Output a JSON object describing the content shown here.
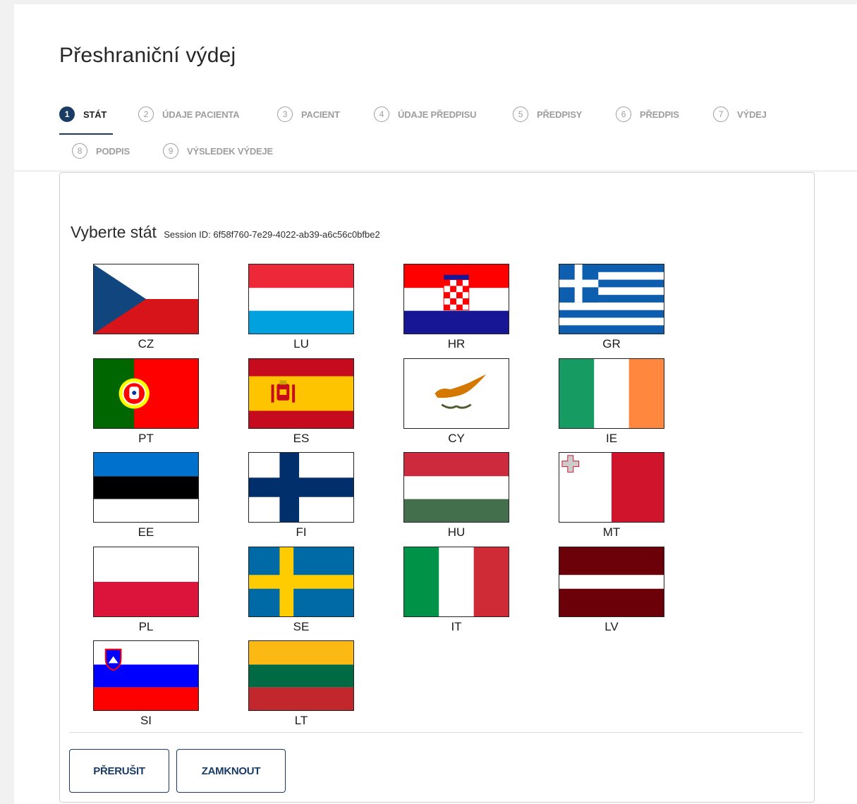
{
  "page": {
    "title": "Přeshraniční výdej"
  },
  "stepper": {
    "steps": [
      {
        "number": "1",
        "label": "STÁT",
        "active": true
      },
      {
        "number": "2",
        "label": "ÚDAJE PACIENTA",
        "active": false
      },
      {
        "number": "3",
        "label": "PACIENT",
        "active": false
      },
      {
        "number": "4",
        "label": "ÚDAJE PŘEDPISU",
        "active": false
      },
      {
        "number": "5",
        "label": "PŘEDPISY",
        "active": false
      },
      {
        "number": "6",
        "label": "PŘEDPIS",
        "active": false
      },
      {
        "number": "7",
        "label": "VÝDEJ",
        "active": false
      },
      {
        "number": "8",
        "label": "PODPIS",
        "active": false
      },
      {
        "number": "9",
        "label": "VÝSLEDEK VÝDEJE",
        "active": false
      }
    ]
  },
  "country_select": {
    "heading": "Vyberte stát",
    "session_label": "Session ID: 6f58f760-7e29-4022-ab39-a6c56c0bfbe2",
    "countries": [
      {
        "code": "CZ",
        "icon": "flag-cz-icon"
      },
      {
        "code": "LU",
        "icon": "flag-lu-icon"
      },
      {
        "code": "HR",
        "icon": "flag-hr-icon"
      },
      {
        "code": "GR",
        "icon": "flag-gr-icon"
      },
      {
        "code": "PT",
        "icon": "flag-pt-icon"
      },
      {
        "code": "ES",
        "icon": "flag-es-icon"
      },
      {
        "code": "CY",
        "icon": "flag-cy-icon"
      },
      {
        "code": "IE",
        "icon": "flag-ie-icon"
      },
      {
        "code": "EE",
        "icon": "flag-ee-icon"
      },
      {
        "code": "FI",
        "icon": "flag-fi-icon"
      },
      {
        "code": "HU",
        "icon": "flag-hu-icon"
      },
      {
        "code": "MT",
        "icon": "flag-mt-icon"
      },
      {
        "code": "PL",
        "icon": "flag-pl-icon"
      },
      {
        "code": "SE",
        "icon": "flag-se-icon"
      },
      {
        "code": "IT",
        "icon": "flag-it-icon"
      },
      {
        "code": "LV",
        "icon": "flag-lv-icon"
      },
      {
        "code": "SI",
        "icon": "flag-si-icon"
      },
      {
        "code": "LT",
        "icon": "flag-lt-icon"
      }
    ]
  },
  "actions": {
    "interrupt_label": "PŘERUŠIT",
    "lock_label": "ZAMKNOUT"
  },
  "colors": {
    "accent": "#1a3b64",
    "inactive": "#9e9e9e"
  }
}
